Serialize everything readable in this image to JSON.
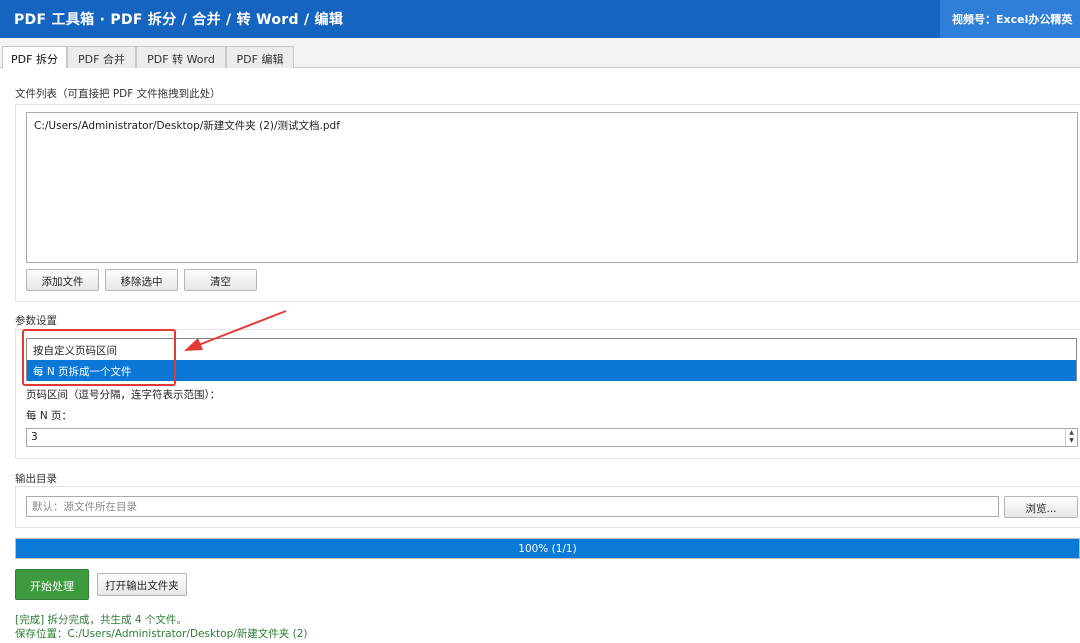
{
  "window": {
    "title": "PDF 工具箱 · PDF 拆分 / 合并 / 转 Word / 编辑",
    "badge": "视频号：Excel办公精英"
  },
  "tabs": [
    {
      "label": "PDF 拆分",
      "active": true
    },
    {
      "label": "PDF 合并",
      "active": false
    },
    {
      "label": "PDF 转 Word",
      "active": false
    },
    {
      "label": "PDF 编辑",
      "active": false
    }
  ],
  "file_list": {
    "label": "文件列表（可直接把 PDF 文件拖拽到此处）",
    "items": [
      "C:/Users/Administrator/Desktop/新建文件夹 (2)/测试文档.pdf"
    ],
    "add_label": "添加文件",
    "remove_label": "移除选中",
    "clear_label": "清空"
  },
  "params": {
    "label": "参数设置",
    "mode_options": [
      {
        "label": "按自定义页码区间",
        "selected": false
      },
      {
        "label": "每 N 页拆成一个文件",
        "selected": true
      }
    ],
    "range_label": "页码区间（逗号分隔，连字符表示范围）：",
    "n_label": "每 N 页：",
    "n_value": "3"
  },
  "output": {
    "label": "输出目录",
    "placeholder": "默认：源文件所在目录",
    "browse_label": "浏览..."
  },
  "progress": {
    "value": 1.0,
    "text": "100%  (1/1)"
  },
  "actions": {
    "start_label": "开始处理",
    "open_folder_label": "打开输出文件夹"
  },
  "status": {
    "line1": "[完成] 拆分完成，共生成 4 个文件。",
    "line2": "保存位置：C:/Users/Administrator/Desktop/新建文件夹 (2)"
  },
  "colors": {
    "titlebar": "#1565c0",
    "selection": "#0b78d7",
    "progress": "#0a7ad6",
    "primary_button": "#3d9a3f",
    "annotation": "#e53935",
    "status_text": "#2e7d32"
  }
}
